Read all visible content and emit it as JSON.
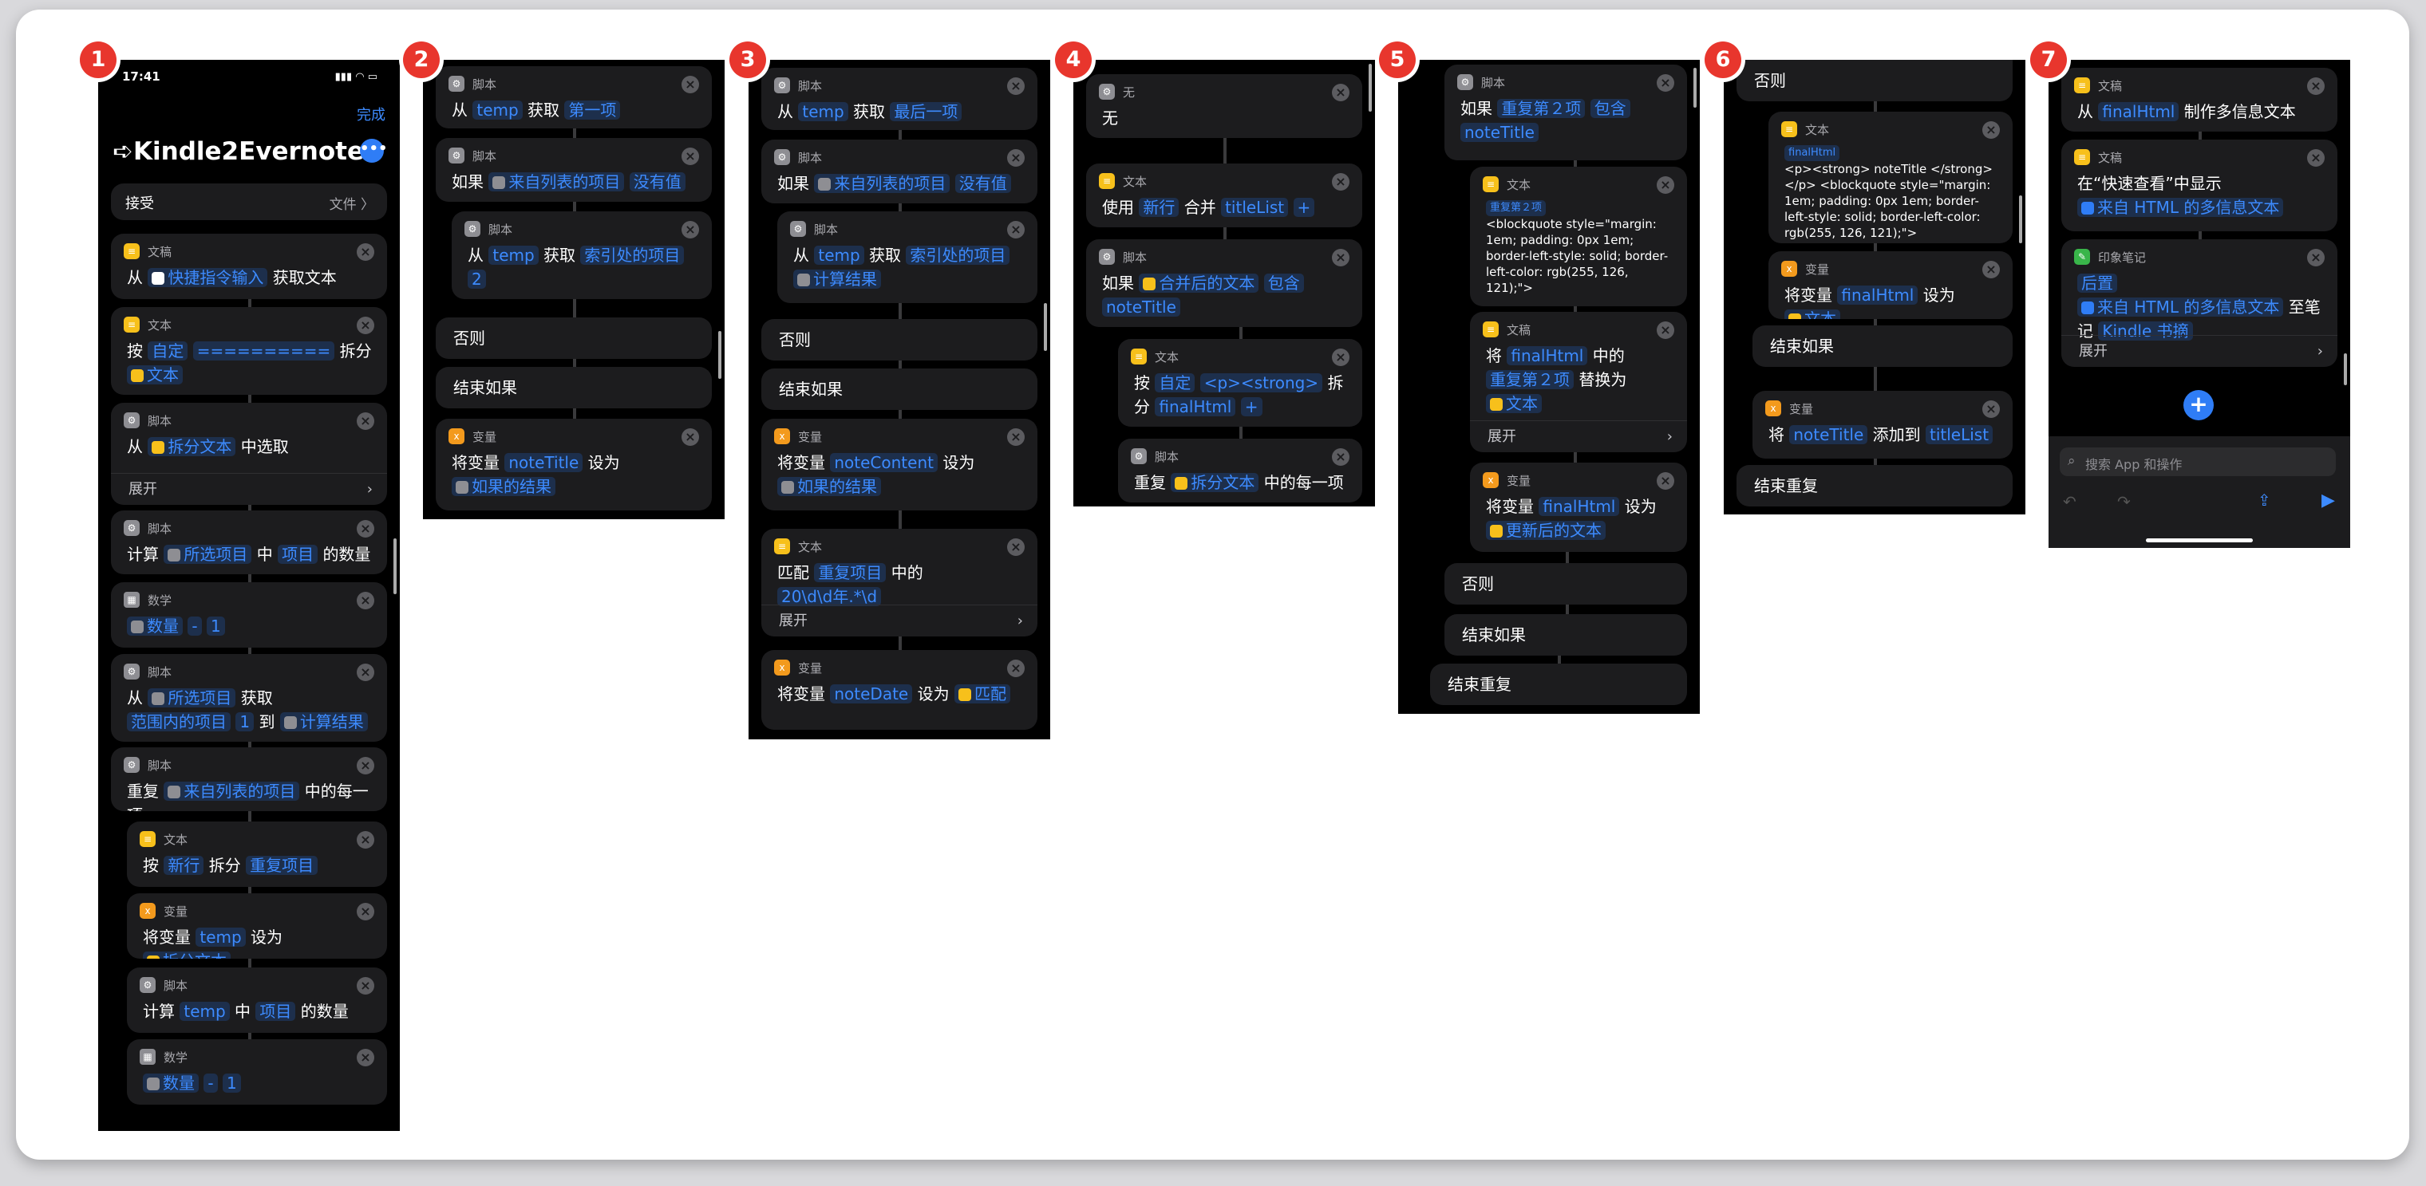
{
  "phone1": {
    "status_time": "17:41",
    "done_label": "完成",
    "title": "➪Kindle2Evernote",
    "accept_label": "接受",
    "accept_value": "文件 〉",
    "blocks": [
      {
        "cat": "文稿",
        "parts": [
          [
            "从",
            0
          ],
          [
            "快捷指令输入",
            1
          ],
          [
            "获取文本",
            0
          ]
        ]
      },
      {
        "cat": "文本",
        "parts": [
          [
            "按",
            0
          ],
          [
            "自定",
            1
          ],
          [
            "==========",
            1
          ],
          [
            "拆分",
            0
          ],
          [
            "文本",
            1
          ]
        ]
      },
      {
        "cat": "脚本",
        "parts": [
          [
            "从",
            0
          ],
          [
            "拆分文本",
            1
          ],
          [
            "中选取",
            0
          ]
        ],
        "expand": "展开"
      },
      {
        "cat": "脚本",
        "parts": [
          [
            "计算",
            0
          ],
          [
            "所选项目",
            1
          ],
          [
            "中",
            0
          ],
          [
            "项目",
            1
          ],
          [
            "的数量",
            0
          ]
        ]
      },
      {
        "cat": "数学",
        "parts": [
          [
            "数量",
            1
          ],
          [
            "-",
            1
          ],
          [
            "1",
            1
          ]
        ]
      },
      {
        "cat": "脚本",
        "parts": [
          [
            "从",
            0
          ],
          [
            "所选项目",
            1
          ],
          [
            "获取",
            0
          ],
          [
            "范围内的项目",
            1
          ],
          [
            "1",
            1
          ],
          [
            "到",
            0
          ],
          [
            "计算结果",
            1
          ]
        ]
      },
      {
        "cat": "脚本",
        "parts": [
          [
            "重复",
            0
          ],
          [
            "来自列表的项目",
            1
          ],
          [
            "中的每一项",
            0
          ]
        ]
      },
      {
        "cat": "文本",
        "parts": [
          [
            "按",
            0
          ],
          [
            "新行",
            1
          ],
          [
            "拆分",
            0
          ],
          [
            "重复项目",
            1
          ]
        ]
      },
      {
        "cat": "变量",
        "parts": [
          [
            "将变量",
            0
          ],
          [
            "temp",
            1
          ],
          [
            "设为",
            0
          ],
          [
            "拆分文本",
            1
          ]
        ]
      },
      {
        "cat": "脚本",
        "parts": [
          [
            "计算",
            0
          ],
          [
            "temp",
            1
          ],
          [
            "中",
            0
          ],
          [
            "项目",
            1
          ],
          [
            "的数量",
            0
          ]
        ]
      },
      {
        "cat": "数学",
        "parts": [
          [
            "数量",
            1
          ],
          [
            "-",
            1
          ],
          [
            "1",
            1
          ]
        ]
      }
    ]
  },
  "phone2": {
    "blocks": [
      {
        "cat": "脚本",
        "parts": [
          [
            "从",
            0
          ],
          [
            "temp",
            1
          ],
          [
            "获取",
            0
          ],
          [
            "第一项",
            1
          ]
        ]
      },
      {
        "cat": "脚本",
        "parts": [
          [
            "如果",
            0
          ],
          [
            "来自列表的项目",
            1
          ],
          [
            "没有值",
            1
          ]
        ]
      },
      {
        "cat": "脚本",
        "parts": [
          [
            "从",
            0
          ],
          [
            "temp",
            1
          ],
          [
            "获取",
            0
          ],
          [
            "索引处的项目",
            1
          ],
          [
            "2",
            1
          ]
        ]
      },
      {
        "cat": "变量",
        "parts": [
          [
            "将变量",
            0
          ],
          [
            "noteTitle",
            1
          ],
          [
            "设为",
            0
          ],
          [
            "如果的结果",
            1
          ]
        ]
      }
    ],
    "otherwise": "否则",
    "end_if": "结束如果"
  },
  "phone3": {
    "blocks": [
      {
        "cat": "脚本",
        "parts": [
          [
            "从",
            0
          ],
          [
            "temp",
            1
          ],
          [
            "获取",
            0
          ],
          [
            "最后一项",
            1
          ]
        ]
      },
      {
        "cat": "脚本",
        "parts": [
          [
            "如果",
            0
          ],
          [
            "来自列表的项目",
            1
          ],
          [
            "没有值",
            1
          ]
        ]
      },
      {
        "cat": "脚本",
        "parts": [
          [
            "从",
            0
          ],
          [
            "temp",
            1
          ],
          [
            "获取",
            0
          ],
          [
            "索引处的项目",
            1
          ],
          [
            "计算结果",
            1
          ]
        ]
      },
      {
        "cat": "变量",
        "parts": [
          [
            "将变量",
            0
          ],
          [
            "noteContent",
            1
          ],
          [
            "设为",
            0
          ],
          [
            "如果的结果",
            1
          ]
        ]
      },
      {
        "cat": "文本",
        "parts": [
          [
            "匹配",
            0
          ],
          [
            "重复项目",
            1
          ],
          [
            "中的",
            0
          ],
          [
            "20\\d\\d年.*\\d",
            1
          ]
        ],
        "expand": "展开"
      },
      {
        "cat": "变量",
        "parts": [
          [
            "将变量",
            0
          ],
          [
            "noteDate",
            1
          ],
          [
            "设为",
            0
          ],
          [
            "匹配",
            1
          ]
        ]
      }
    ],
    "otherwise": "否则",
    "end_if": "结束如果"
  },
  "phone4": {
    "blocks": [
      {
        "cat": "无",
        "parts": [
          [
            "无",
            0
          ]
        ]
      },
      {
        "cat": "文本",
        "parts": [
          [
            "使用",
            0
          ],
          [
            "新行",
            1
          ],
          [
            "合并",
            0
          ],
          [
            "titleList",
            1
          ],
          [
            "+",
            1
          ]
        ]
      },
      {
        "cat": "脚本",
        "parts": [
          [
            "如果",
            0
          ],
          [
            "合并后的文本",
            1
          ],
          [
            "包含",
            1
          ],
          [
            "noteTitle",
            1
          ]
        ]
      },
      {
        "cat": "文本",
        "parts": [
          [
            "按",
            0
          ],
          [
            "自定",
            1
          ],
          [
            "<p><strong>",
            1
          ],
          [
            "拆分",
            0
          ],
          [
            "finalHtml",
            1
          ],
          [
            "+",
            1
          ]
        ]
      },
      {
        "cat": "脚本",
        "parts": [
          [
            "重复",
            0
          ],
          [
            "拆分文本",
            1
          ],
          [
            "中的每一项",
            0
          ]
        ]
      }
    ]
  },
  "phone5": {
    "blocks": [
      {
        "cat": "脚本",
        "parts": [
          [
            "如果",
            0
          ],
          [
            "重复第２项",
            1
          ],
          [
            "包含",
            1
          ],
          [
            "noteTitle",
            1
          ]
        ]
      },
      {
        "cat": "文本",
        "tag": "重复第２项",
        "text": "<blockquote style=\"margin: 1em; padding: 0px 1em; border-left-style: solid; border-left-color: rgb(255, 126, 121);\">"
      },
      {
        "cat": "文稿",
        "parts": [
          [
            "将",
            0
          ],
          [
            "finalHtml",
            1
          ],
          [
            "中的",
            0
          ],
          [
            "重复第２项",
            1
          ],
          [
            "替换为",
            0
          ],
          [
            "文本",
            1
          ]
        ],
        "expand": "展开"
      },
      {
        "cat": "变量",
        "parts": [
          [
            "将变量",
            0
          ],
          [
            "finalHtml",
            1
          ],
          [
            "设为",
            0
          ],
          [
            "更新后的文本",
            1
          ]
        ]
      }
    ],
    "otherwise": "否则",
    "end_if": "结束如果",
    "end_repeat": "结束重复"
  },
  "phone6": {
    "otherwise": "否则",
    "blocks": [
      {
        "cat": "文本",
        "tag": "finalHtml",
        "text": "<p><strong> noteTitle </strong></p> <blockquote style=\"margin: 1em; padding: 0px 1em; border-left-style: solid; border-left-color: rgb(255, 126, 121);\">"
      },
      {
        "cat": "变量",
        "parts": [
          [
            "将变量",
            0
          ],
          [
            "finalHtml",
            1
          ],
          [
            "设为",
            0
          ],
          [
            "文本",
            1
          ]
        ]
      },
      {
        "cat": "变量",
        "parts": [
          [
            "将",
            0
          ],
          [
            "noteTitle",
            1
          ],
          [
            "添加到",
            0
          ],
          [
            "titleList",
            1
          ]
        ]
      }
    ],
    "end_if": "结束如果",
    "end_repeat": "结束重复"
  },
  "phone7": {
    "blocks": [
      {
        "cat": "文稿",
        "parts": [
          [
            "从",
            0
          ],
          [
            "finalHtml",
            1
          ],
          [
            "制作多信息文本",
            0
          ]
        ]
      },
      {
        "cat": "文稿",
        "parts": [
          [
            "在“快速查看”中显示",
            0
          ],
          [
            "来自 HTML 的多信息文本",
            1
          ]
        ]
      },
      {
        "cat": "印象笔记",
        "parts": [
          [
            "后置",
            1
          ],
          [
            "来自 HTML 的多信息文本",
            1
          ],
          [
            "至笔记",
            0
          ],
          [
            "Kindle 书摘",
            1
          ]
        ],
        "expand": "展开"
      }
    ],
    "search_placeholder": "搜索 App 和操作"
  },
  "badges": [
    "1",
    "2",
    "3",
    "4",
    "5",
    "6",
    "7"
  ]
}
